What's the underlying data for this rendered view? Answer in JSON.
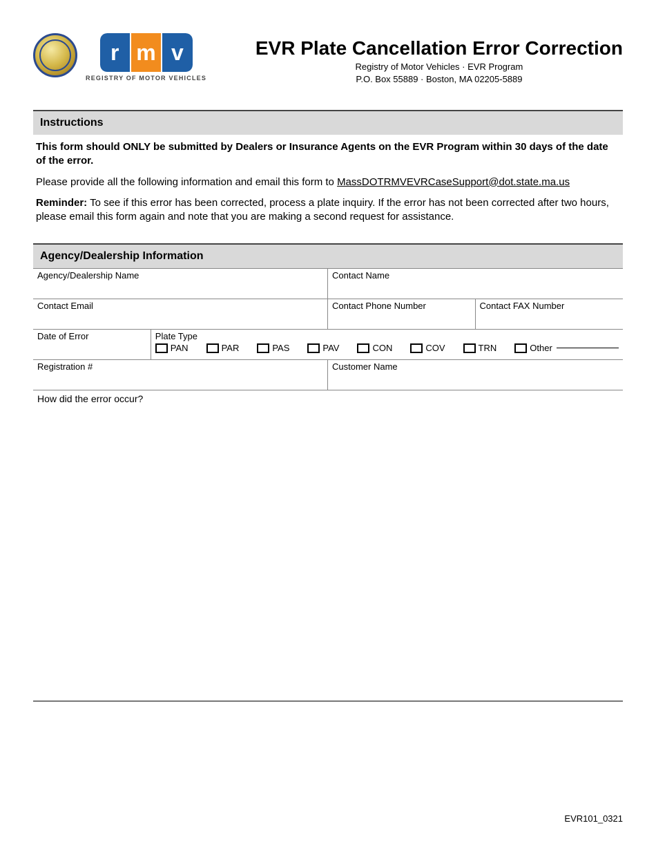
{
  "header": {
    "rmv_letters": {
      "r": "r",
      "m": "m",
      "v": "v"
    },
    "rmv_caption": "REGISTRY OF MOTOR VEHICLES",
    "title": "EVR Plate Cancellation Error Correction",
    "org_line": "Registry of Motor Vehicles · EVR Program",
    "addr_line": "P.O. Box 55889 · Boston, MA 02205-5889"
  },
  "instructions": {
    "heading": "Instructions",
    "p1": "This form should ONLY be submitted by Dealers or Insurance Agents on the EVR Program within 30 days of the date of the error.",
    "p2_pre": "Please provide all the following information and email this form to ",
    "p2_email": "MassDOTRMVEVRCaseSupport@dot.state.ma.us",
    "p3_label": "Reminder:",
    "p3_body": " To see if this error has been corrected, process a plate inquiry. If the error has not been corrected after two hours, please email this form again and note that you are making a second request for assistance."
  },
  "agency": {
    "heading": "Agency/Dealership Information",
    "labels": {
      "agency_name": "Agency/Dealership Name",
      "contact_name": "Contact Name",
      "contact_email": "Contact Email",
      "contact_phone": "Contact Phone Number",
      "contact_fax": "Contact FAX Number",
      "date_of_error": "Date of Error",
      "plate_type": "Plate Type",
      "registration": "Registration #",
      "customer_name": "Customer Name",
      "error_q": "How did the error occur?"
    },
    "plate_types": {
      "pan": "PAN",
      "par": "PAR",
      "pas": "PAS",
      "pav": "PAV",
      "con": "CON",
      "cov": "COV",
      "trn": "TRN",
      "other": "Other"
    }
  },
  "footer": {
    "form_id": "EVR101_0321"
  }
}
